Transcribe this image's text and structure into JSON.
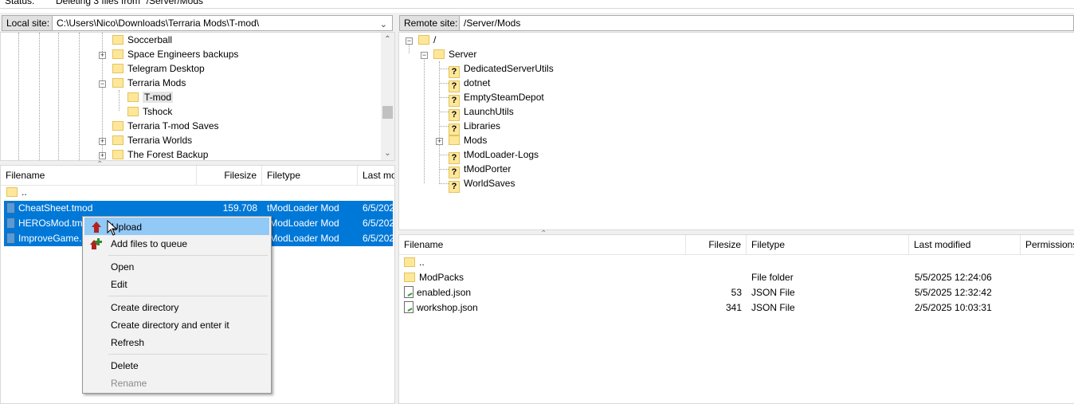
{
  "status": {
    "label": "Status:",
    "text": "Deleting 3 files from \"/Server/Mods\""
  },
  "local": {
    "site_label": "Local site:",
    "site_path": "C:\\Users\\Nico\\Downloads\\Terraria Mods\\T-mod\\",
    "tree": [
      {
        "label": "Soccerball"
      },
      {
        "label": "Space Engineers backups"
      },
      {
        "label": "Telegram Desktop"
      },
      {
        "label": "Terraria Mods"
      },
      {
        "label": "T-mod"
      },
      {
        "label": "Tshock"
      },
      {
        "label": "Terraria T-mod Saves"
      },
      {
        "label": "Terraria Worlds"
      },
      {
        "label": "The Forest Backup"
      }
    ],
    "columns": {
      "filename": "Filename",
      "filesize": "Filesize",
      "filetype": "Filetype",
      "last_modified": "Last mo"
    },
    "parent_row": "..",
    "files": [
      {
        "name": "CheatSheet.tmod",
        "size": "159.708",
        "type": "tModLoader Mod",
        "modified": "6/5/202"
      },
      {
        "name": "HEROsMod.tm",
        "size": "",
        "type": "tModLoader Mod",
        "modified": "6/5/202"
      },
      {
        "name": "ImproveGame.",
        "size": "",
        "type": "tModLoader Mod",
        "modified": "6/5/202"
      }
    ]
  },
  "remote": {
    "site_label": "Remote site:",
    "site_path": "/Server/Mods",
    "tree": [
      {
        "label": "/"
      },
      {
        "label": "Server"
      },
      {
        "label": "DedicatedServerUtils"
      },
      {
        "label": "dotnet"
      },
      {
        "label": "EmptySteamDepot"
      },
      {
        "label": "LaunchUtils"
      },
      {
        "label": "Libraries"
      },
      {
        "label": "Mods"
      },
      {
        "label": "tModLoader-Logs"
      },
      {
        "label": "tModPorter"
      },
      {
        "label": "WorldSaves"
      }
    ],
    "columns": {
      "filename": "Filename",
      "filesize": "Filesize",
      "filetype": "Filetype",
      "last_modified": "Last modified",
      "permissions": "Permissions"
    },
    "parent_row": "..",
    "files": [
      {
        "name": "ModPacks",
        "size": "",
        "type": "File folder",
        "modified": "5/5/2025 12:24:06"
      },
      {
        "name": "enabled.json",
        "size": "53",
        "type": "JSON File",
        "modified": "5/5/2025 12:32:42"
      },
      {
        "name": "workshop.json",
        "size": "341",
        "type": "JSON File",
        "modified": "2/5/2025 10:03:31"
      }
    ]
  },
  "context_menu": {
    "items": [
      {
        "label": "Upload"
      },
      {
        "label": "Add files to queue"
      },
      {
        "label": "Open"
      },
      {
        "label": "Edit"
      },
      {
        "label": "Create directory"
      },
      {
        "label": "Create directory and enter it"
      },
      {
        "label": "Refresh"
      },
      {
        "label": "Delete"
      },
      {
        "label": "Rename"
      }
    ]
  },
  "colors": {
    "selection": "#0078d7",
    "menu_hover": "#91c9f7",
    "folder": "#ffe79a"
  }
}
